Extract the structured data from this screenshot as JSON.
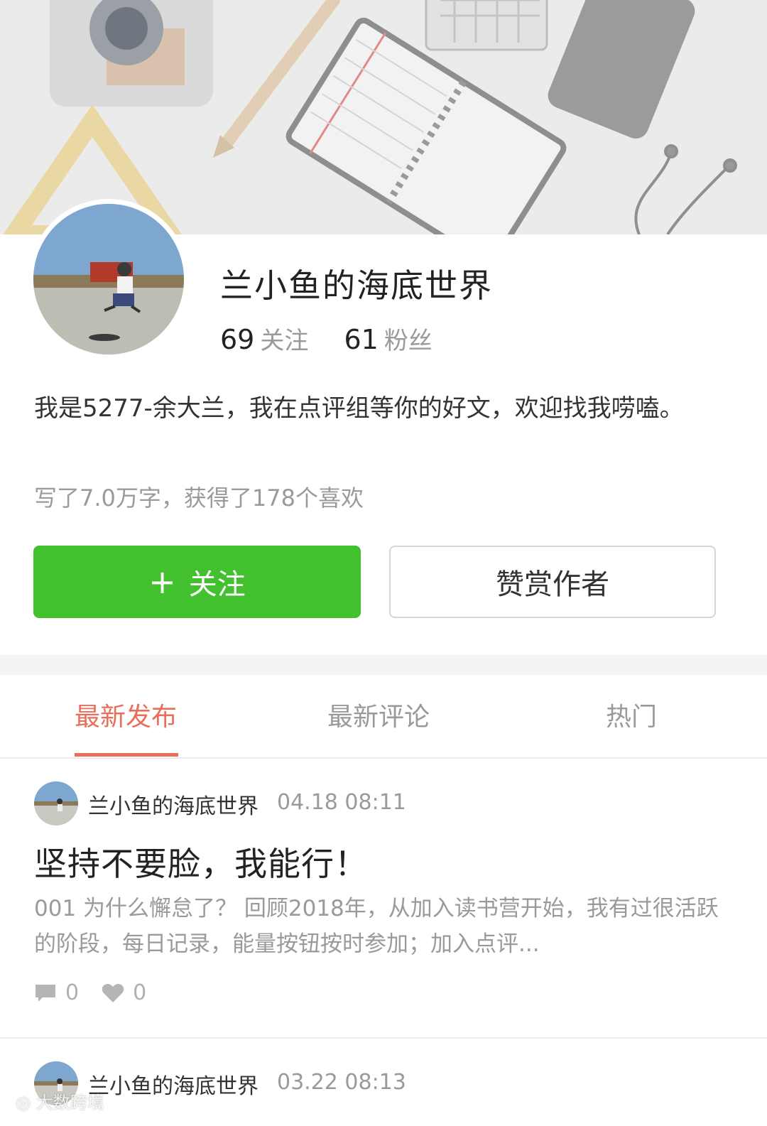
{
  "profile": {
    "name": "兰小鱼的海底世界",
    "following_count": "69",
    "following_label": "关注",
    "followers_count": "61",
    "followers_label": "粉丝",
    "bio": "我是5277-余大兰，我在点评组等你的好文，欢迎找我唠嗑。",
    "summary": "写了7.0万字，获得了178个喜欢"
  },
  "actions": {
    "follow_plus": "+",
    "follow_label": "关注",
    "reward_label": "赞赏作者"
  },
  "tabs": [
    {
      "label": "最新发布",
      "active": true
    },
    {
      "label": "最新评论",
      "active": false
    },
    {
      "label": "热门",
      "active": false
    }
  ],
  "posts": [
    {
      "author": "兰小鱼的海底世界",
      "time": "04.18 08:11",
      "title": "坚持不要脸，我能行！",
      "excerpt": "001 为什么懈怠了？ 回顾2018年，从加入读书营开始，我有过很活跃的阶段，每日记录，能量按钮按时参加；加入点评...",
      "comments": "0",
      "likes": "0"
    },
    {
      "author": "兰小鱼的海底世界",
      "time": "03.22 08:13"
    }
  ],
  "watermark": "大数跨境",
  "colors": {
    "accent": "#ea6f5a",
    "follow_green": "#42c02e",
    "muted_text": "#9a9a9a"
  }
}
